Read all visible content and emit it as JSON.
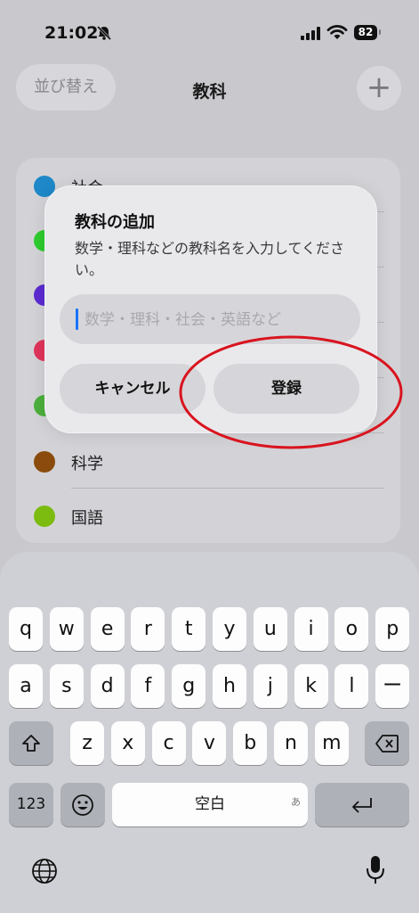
{
  "status": {
    "time": "21:02",
    "battery": "82"
  },
  "nav": {
    "sort_label": "並び替え",
    "title": "教科",
    "add_label": "+"
  },
  "list": {
    "items": [
      {
        "label": "社会",
        "color": "#1e88c8"
      },
      {
        "label": "",
        "color": "#2ecc2e"
      },
      {
        "label": "",
        "color": "#5a2bd0"
      },
      {
        "label": "",
        "color": "#e0345a"
      },
      {
        "label": "",
        "color": "#4caf3c"
      },
      {
        "label": "科学",
        "color": "#8a4b0c"
      },
      {
        "label": "国語",
        "color": "#7cbb10"
      }
    ]
  },
  "dialog": {
    "title": "教科の追加",
    "message": "数学・理科などの教科名を入力してください。",
    "input_value": "",
    "input_placeholder": "数学・理科・社会・英語など",
    "cancel_label": "キャンセル",
    "register_label": "登録"
  },
  "annotation": {
    "color": "#d9141f"
  },
  "keyboard": {
    "row1": [
      "q",
      "w",
      "e",
      "r",
      "t",
      "y",
      "u",
      "i",
      "o",
      "p"
    ],
    "row2": [
      "a",
      "s",
      "d",
      "f",
      "g",
      "h",
      "j",
      "k",
      "l",
      "ー"
    ],
    "row3": [
      "z",
      "x",
      "c",
      "v",
      "b",
      "n",
      "m"
    ],
    "num_label": "123",
    "space_label": "空白",
    "space_hint": "あ"
  }
}
